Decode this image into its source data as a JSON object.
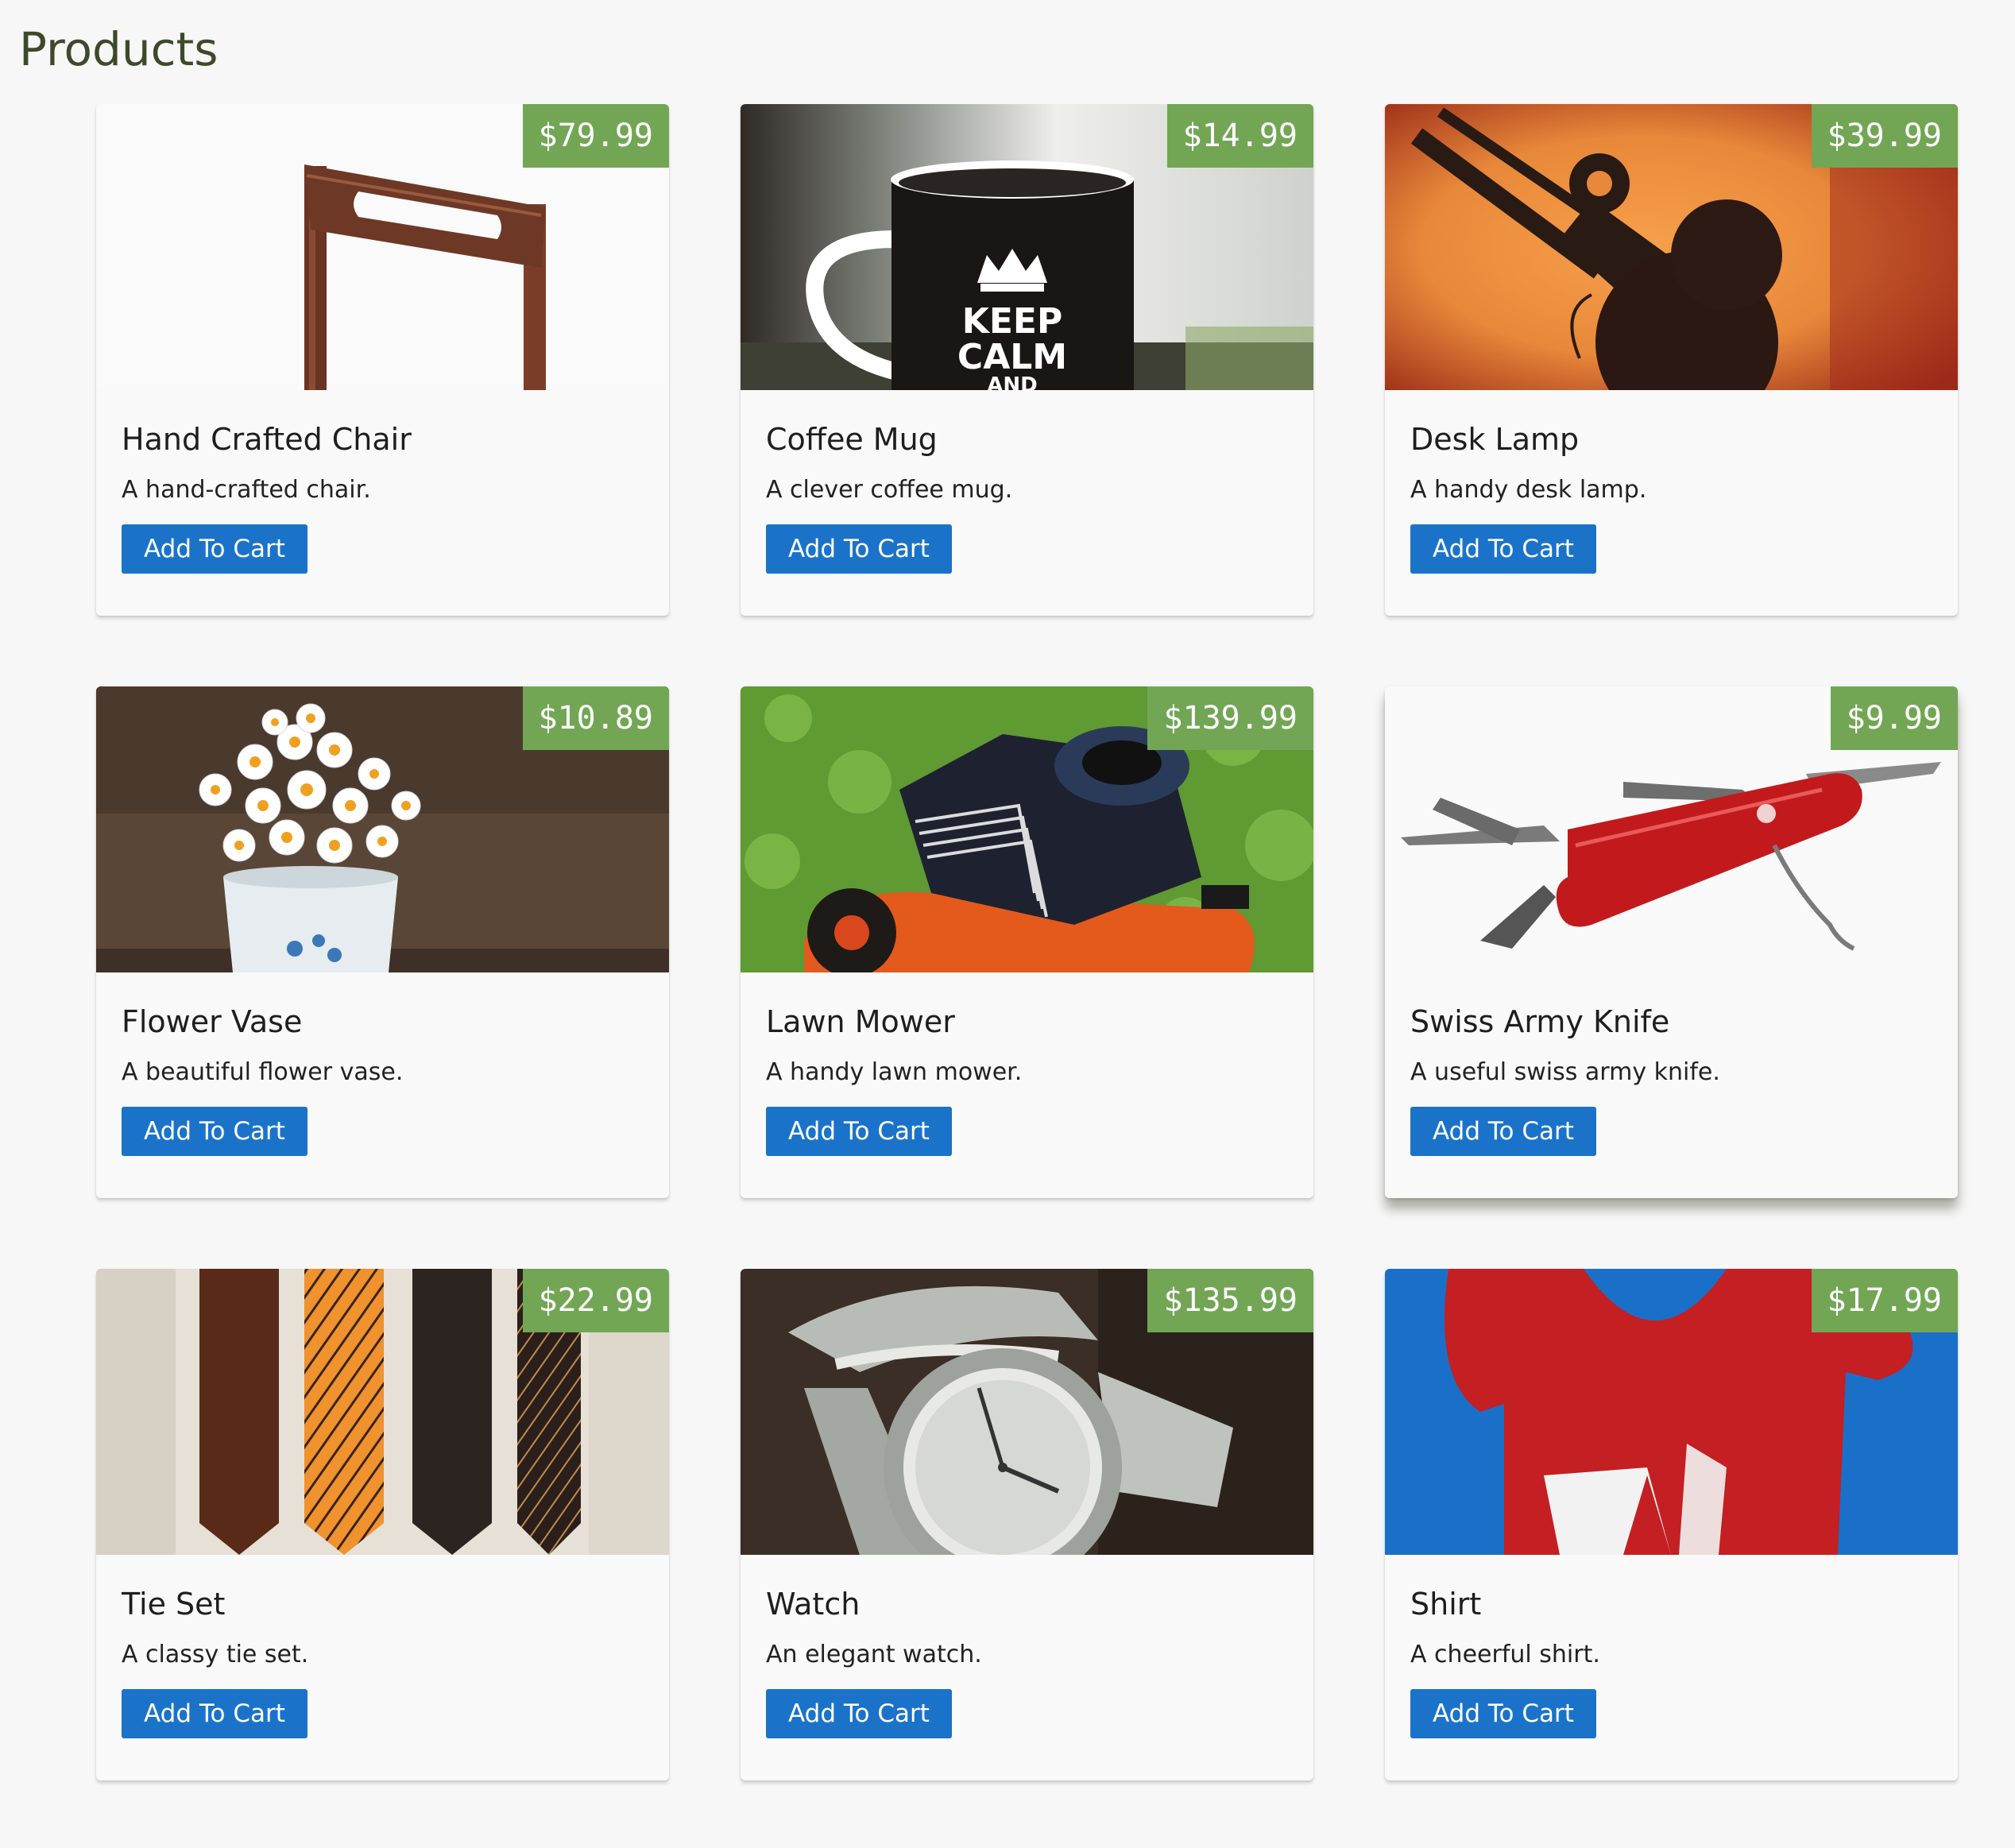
{
  "page": {
    "title": "Products"
  },
  "products": [
    {
      "name": "Hand Crafted Chair",
      "description": "A hand-crafted chair.",
      "price": "$79.99",
      "button": "Add To Cart",
      "image_icon": "chair-image"
    },
    {
      "name": "Coffee Mug",
      "description": "A clever coffee mug.",
      "price": "$14.99",
      "button": "Add To Cart",
      "image_icon": "mug-image",
      "mug_text": [
        "KEEP",
        "CALM",
        "AND"
      ]
    },
    {
      "name": "Desk Lamp",
      "description": "A handy desk lamp.",
      "price": "$39.99",
      "button": "Add To Cart",
      "image_icon": "lamp-image"
    },
    {
      "name": "Flower Vase",
      "description": "A beautiful flower vase.",
      "price": "$10.89",
      "button": "Add To Cart",
      "image_icon": "vase-image"
    },
    {
      "name": "Lawn Mower",
      "description": "A handy lawn mower.",
      "price": "$139.99",
      "button": "Add To Cart",
      "image_icon": "mower-image"
    },
    {
      "name": "Swiss Army Knife",
      "description": "A useful swiss army knife.",
      "price": "$9.99",
      "button": "Add To Cart",
      "image_icon": "knife-image"
    },
    {
      "name": "Tie Set",
      "description": "A classy tie set.",
      "price": "$22.99",
      "button": "Add To Cart",
      "image_icon": "ties-image"
    },
    {
      "name": "Watch",
      "description": "An elegant watch.",
      "price": "$135.99",
      "button": "Add To Cart",
      "image_icon": "watch-image"
    },
    {
      "name": "Shirt",
      "description": "A cheerful shirt.",
      "price": "$17.99",
      "button": "Add To Cart",
      "image_icon": "shirt-image"
    }
  ],
  "colors": {
    "price_badge": "#72a655",
    "button": "#1a73c9",
    "title": "#3d4a2a",
    "background": "#f7f7f7"
  }
}
